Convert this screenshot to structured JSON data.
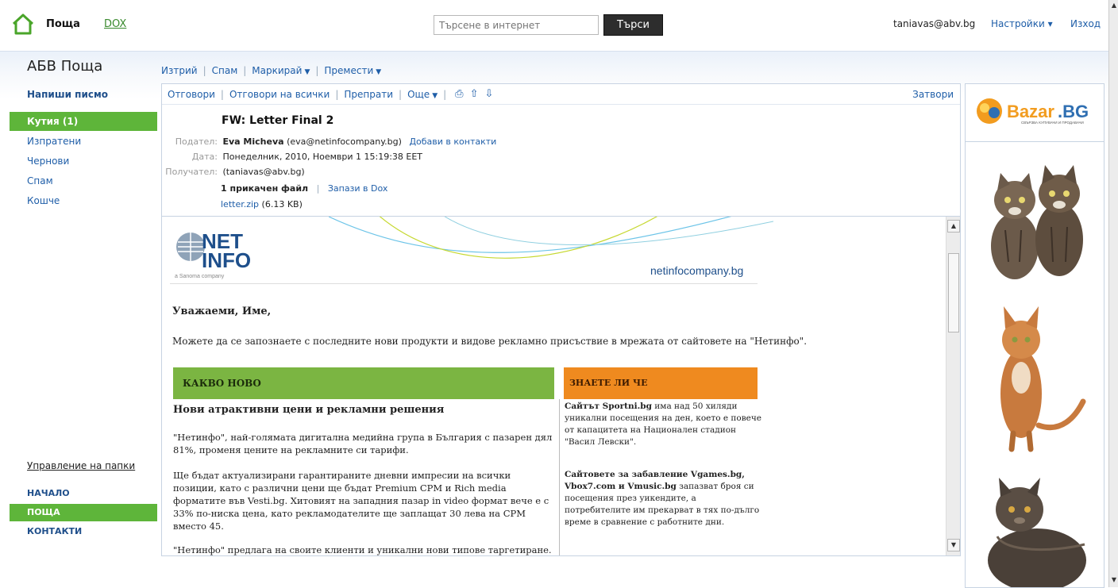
{
  "header": {
    "brand": "Поща",
    "dox": "DOX",
    "search": {
      "placeholder": "Търсене в интернет",
      "button": "Търси"
    },
    "user_email": "taniavas@abv.bg",
    "settings": "Настройки ▾",
    "logout": "Изход"
  },
  "sidebar": {
    "title": "АБВ Поща",
    "compose": "Напиши писмо",
    "folders": [
      {
        "label": "Кутия (1)",
        "active": true
      },
      {
        "label": "Изпратени",
        "active": false
      },
      {
        "label": "Чернови",
        "active": false
      },
      {
        "label": "Спам",
        "active": false
      },
      {
        "label": "Кошче",
        "active": false
      }
    ],
    "manage_folders": "Управление на папки",
    "bottom_nav": [
      {
        "label": "НАЧАЛО",
        "active": false
      },
      {
        "label": "ПОЩА",
        "active": true
      },
      {
        "label": "КОНТАКТИ",
        "active": false
      }
    ]
  },
  "actions": {
    "delete": "Изтрий",
    "spam": "Спам",
    "mark": "Маркирай",
    "move": "Премести"
  },
  "message_toolbar": {
    "reply": "Отговори",
    "reply_all": "Отговори на всички",
    "forward": "Препрати",
    "more": "Още",
    "close": "Затвори"
  },
  "message": {
    "subject": "FW: Letter Final 2",
    "from_label": "Подател:",
    "from_name": "Eva Micheva",
    "from_email": "(eva@netinfocompany.bg)",
    "add_contact": "Добави в контакти",
    "date_label": "Дата:",
    "date": "Понеделник, 2010, Ноември 1 15:19:38 EET",
    "to_label": "Получател:",
    "to": "(taniavas@abv.bg)",
    "attachments_count": "1 прикачен файл",
    "save_dox": "Запази в Dox",
    "attachment_name": "letter.zip",
    "attachment_size": "(6.13 KB)"
  },
  "email_body": {
    "logo_tagline": "a Sanoma company",
    "url": "netinfocompany.bg",
    "greeting": "Уважаеми, Име,",
    "intro": "Можете да се запознаете с последните нови продукти и видове рекламно присъствие в мрежата от сайтовете на \"Нетинфо\".",
    "what_new_heading": "КАКВО НОВО",
    "did_you_know_heading": "ЗНАЕТЕ ЛИ ЧЕ",
    "news_title": "Нови атрактивни цени и рекламни решения",
    "news_p1": "\"Нетинфо\", най-голямата дигитална медийна група в България с пазарен дял 81%, променя цените на рекламните си тарифи.",
    "news_p2": "Ще бъдат актуализирани гарантираните дневни импресии на всички позиции, като с различни цени ще бъдат Premium CPM и Rich media форматите във Vesti.bg. Хитовият на западния пазар in video формат вече е с 33% по-ниска цена, като рекламодателите ще заплащат 30 лева на CPM вместо 45.",
    "news_p3": "\"Нетинфо\" предлага на своите клиенти и уникални нови типове таргетиране. Всеки",
    "know_p1_bold": "Сайтът Sportni.bg",
    "know_p1": " има над 50 хиляди уникални посещения на ден, което е повече от капацитета на Национален стадион \"Васил Левски\".",
    "know_p2_bold": "Сайтовете за забавление Vgames.bg, Vbox7.com и Vmusic.bg",
    "know_p2": " запазват броя си посещения през уикендите, а потребителите им прекарват в тях по-дълго време в сравнение с работните дни."
  },
  "ad": {
    "brand": "Bazar.BG",
    "tagline": "СВЪРЗВА КУПУВАЧИ И ПРОДАВАЧИ"
  },
  "colors": {
    "green": "#5eb53a",
    "link": "#1f5ea8",
    "orange": "#ef8a1f",
    "news_green": "#7bb542"
  }
}
